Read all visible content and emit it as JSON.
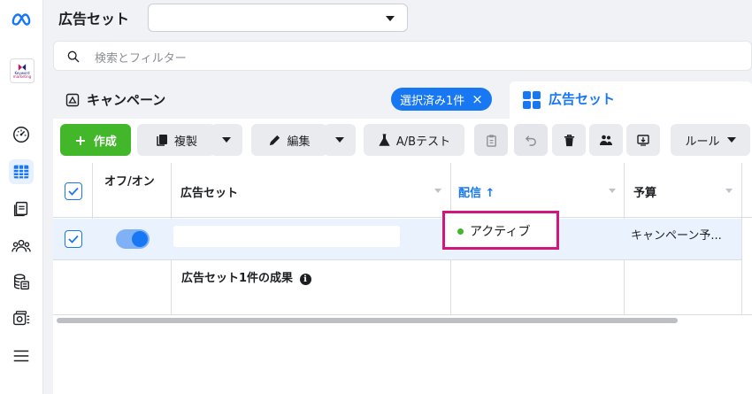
{
  "header": {
    "title": "広告セット"
  },
  "search": {
    "placeholder": "検索とフィルター"
  },
  "tabs": {
    "campaign_label": "キャンペーン",
    "selected_chip": "選択済み1件",
    "selected_chip_close": "×",
    "adset_label": "広告セット"
  },
  "rail": {
    "brand_text_1": "Keyword",
    "brand_text_2": "marketing"
  },
  "toolbar": {
    "create": "作成",
    "create_plus": "+",
    "duplicate": "複製",
    "edit": "編集",
    "ab_test": "A/Bテスト",
    "rules": "ルール"
  },
  "table": {
    "headers": {
      "toggle": "オフ/オン",
      "name": "広告セット",
      "delivery": "配信 ↑",
      "budget": "予算"
    },
    "row": {
      "delivery": "アクティブ",
      "budget": "キャンペーン予..."
    },
    "summary": {
      "label": "広告セット1件の成果",
      "info_icon": "ℹ"
    }
  },
  "colors": {
    "accent": "#1877f2",
    "create_green": "#42b72a",
    "highlight_border": "#d3167e",
    "status_active": "#42b72a"
  }
}
